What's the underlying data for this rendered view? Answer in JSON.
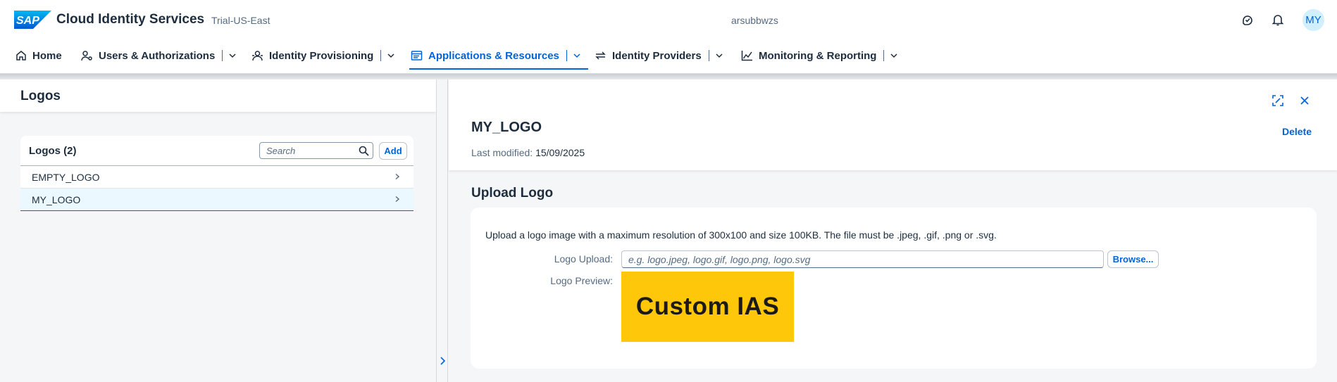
{
  "shell": {
    "logo_text": "SAP",
    "app_title": "Cloud Identity Services",
    "tenant": "Trial-US-East",
    "subdomain": "arsubbwzs",
    "avatar_initials": "MY",
    "actions": [
      "support-icon",
      "notifications-icon"
    ]
  },
  "nav": {
    "items": [
      {
        "label": "Home",
        "icon": "home-icon"
      },
      {
        "label": "Users & Authorizations",
        "icon": "user-settings-icon"
      },
      {
        "label": "Identity Provisioning",
        "icon": "provisioning-icon"
      },
      {
        "label": "Applications & Resources",
        "icon": "applications-icon",
        "active": true
      },
      {
        "label": "Identity Providers",
        "icon": "sync-icon"
      },
      {
        "label": "Monitoring & Reporting",
        "icon": "line-chart-icon"
      }
    ]
  },
  "list": {
    "page_title": "Logos",
    "title": "Logos (2)",
    "search_placeholder": "Search",
    "add_label": "Add",
    "items": [
      {
        "label": "EMPTY_LOGO",
        "selected": false
      },
      {
        "label": "MY_LOGO",
        "selected": true
      }
    ]
  },
  "detail": {
    "title": "MY_LOGO",
    "modified_label": "Last modified:",
    "modified_value": "15/09/2025",
    "delete_label": "Delete",
    "section_title": "Upload Logo",
    "help_text": "Upload a logo image with a maximum resolution of 300x100 and size 100KB. The file must be .jpeg, .gif, .png or .svg.",
    "upload_label": "Logo Upload:",
    "upload_placeholder": "e.g. logo.jpeg, logo.gif, logo.png, logo.svg",
    "browse_label": "Browse...",
    "preview_label": "Logo Preview:",
    "preview_text": "Custom IAS"
  },
  "colors": {
    "accent": "#0064d9",
    "text": "#1d2d3e",
    "muted": "#556b82",
    "selected_row": "#ebf8ff",
    "logo_bg": "#ffc70a"
  }
}
